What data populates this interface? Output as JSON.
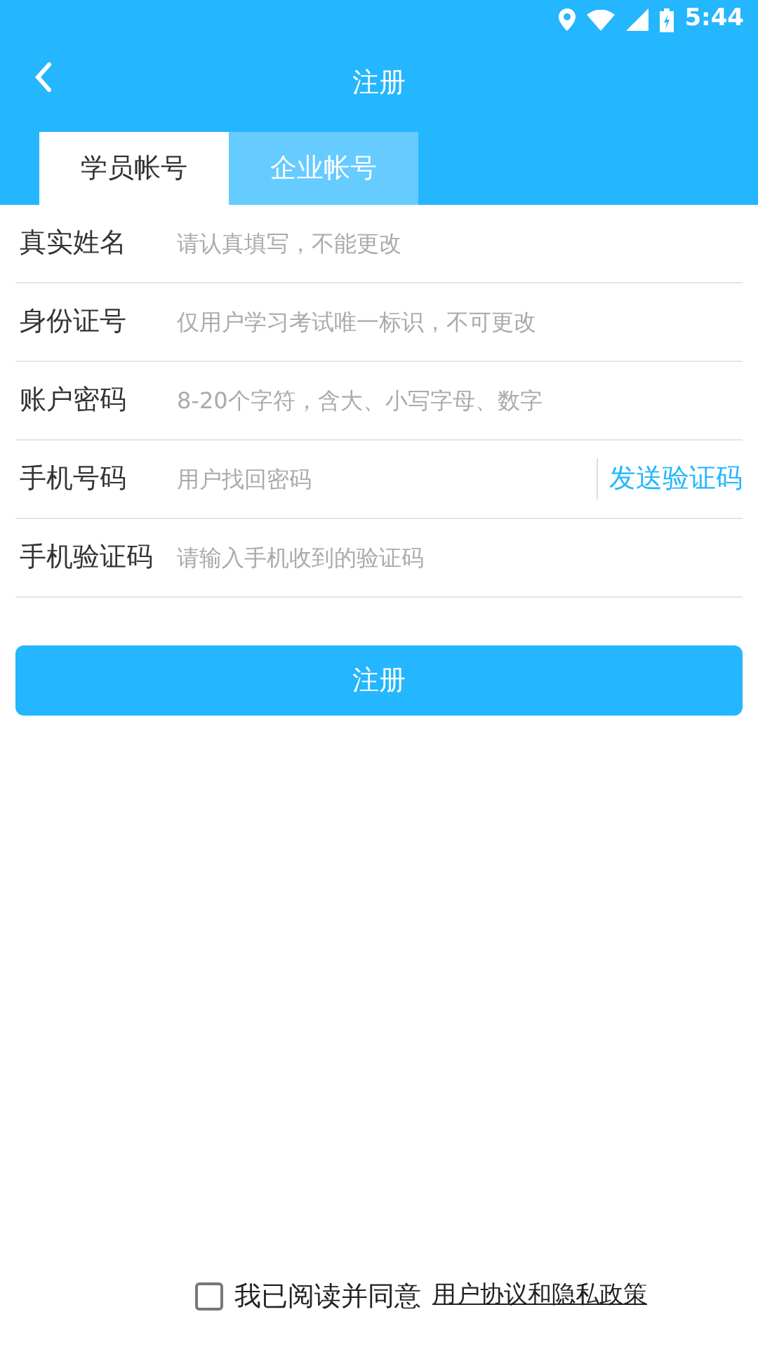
{
  "status_bar": {
    "time": "5:44"
  },
  "header": {
    "title": "注册"
  },
  "tabs": [
    {
      "label": "学员帐号",
      "selected": true
    },
    {
      "label": "企业帐号",
      "selected": false
    }
  ],
  "fields": [
    {
      "label": "真实姓名",
      "placeholder": "请认真填写，不能更改"
    },
    {
      "label": "身份证号",
      "placeholder": "仅用户学习考试唯一标识，不可更改"
    },
    {
      "label": "账户密码",
      "placeholder": "8-20个字符，含大、小写字母、数字"
    },
    {
      "label": "手机号码",
      "placeholder": "用户找回密码",
      "action": "发送验证码"
    },
    {
      "label": "手机验证码",
      "placeholder": "请输入手机收到的验证码"
    }
  ],
  "submit": "注册",
  "agreement": {
    "checked": false,
    "text": "我已阅读并同意",
    "link": "用户协议和隐私政策"
  }
}
